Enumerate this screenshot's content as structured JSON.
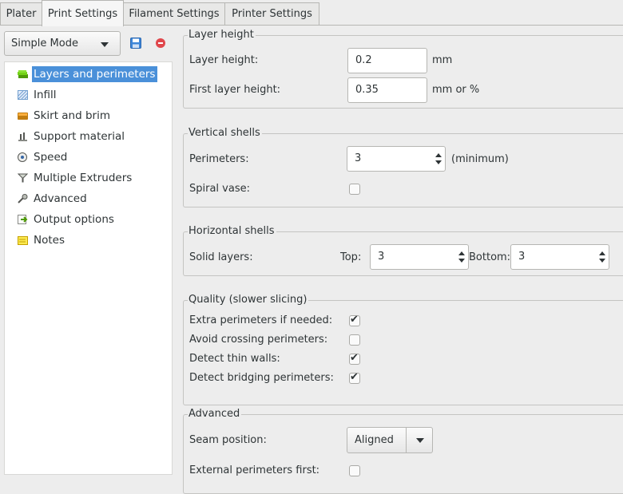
{
  "tabs": [
    {
      "label": "Plater",
      "active": false
    },
    {
      "label": "Print Settings",
      "active": true
    },
    {
      "label": "Filament Settings",
      "active": false
    },
    {
      "label": "Printer Settings",
      "active": false
    }
  ],
  "sidebar": {
    "mode": "Simple Mode",
    "items": [
      {
        "label": "Layers and perimeters",
        "icon": "layers-icon",
        "selected": true
      },
      {
        "label": "Infill",
        "icon": "infill-icon"
      },
      {
        "label": "Skirt and brim",
        "icon": "skirt-icon"
      },
      {
        "label": "Support material",
        "icon": "support-icon"
      },
      {
        "label": "Speed",
        "icon": "speed-icon"
      },
      {
        "label": "Multiple Extruders",
        "icon": "extruders-icon"
      },
      {
        "label": "Advanced",
        "icon": "wrench-icon"
      },
      {
        "label": "Output options",
        "icon": "output-icon"
      },
      {
        "label": "Notes",
        "icon": "notes-icon"
      }
    ]
  },
  "groups": {
    "layer_height": {
      "title": "Layer height",
      "layer_height_label": "Layer height:",
      "layer_height_value": "0.2",
      "layer_height_unit": "mm",
      "first_layer_label": "First layer height:",
      "first_layer_value": "0.35",
      "first_layer_unit": "mm or %"
    },
    "vertical_shells": {
      "title": "Vertical shells",
      "perimeters_label": "Perimeters:",
      "perimeters_value": "3",
      "perimeters_unit": "(minimum)",
      "spiral_label": "Spiral vase:",
      "spiral_checked": false
    },
    "horizontal_shells": {
      "title": "Horizontal shells",
      "solid_label": "Solid layers:",
      "top_label": "Top:",
      "top_value": "3",
      "bottom_label": "Bottom:",
      "bottom_value": "3"
    },
    "quality": {
      "title": "Quality (slower slicing)",
      "extra_label": "Extra perimeters if needed:",
      "extra_checked": true,
      "avoid_label": "Avoid crossing perimeters:",
      "avoid_checked": false,
      "thin_label": "Detect thin walls:",
      "thin_checked": true,
      "bridging_label": "Detect bridging perimeters:",
      "bridging_checked": true
    },
    "advanced": {
      "title": "Advanced",
      "seam_label": "Seam position:",
      "seam_value": "Aligned",
      "external_label": "External perimeters first:",
      "external_checked": false
    }
  },
  "check_glyph": "✔",
  "colors": {
    "selection": "#4a90d9",
    "save_icon": "#3d86d8",
    "delete_icon": "#e0474c"
  }
}
